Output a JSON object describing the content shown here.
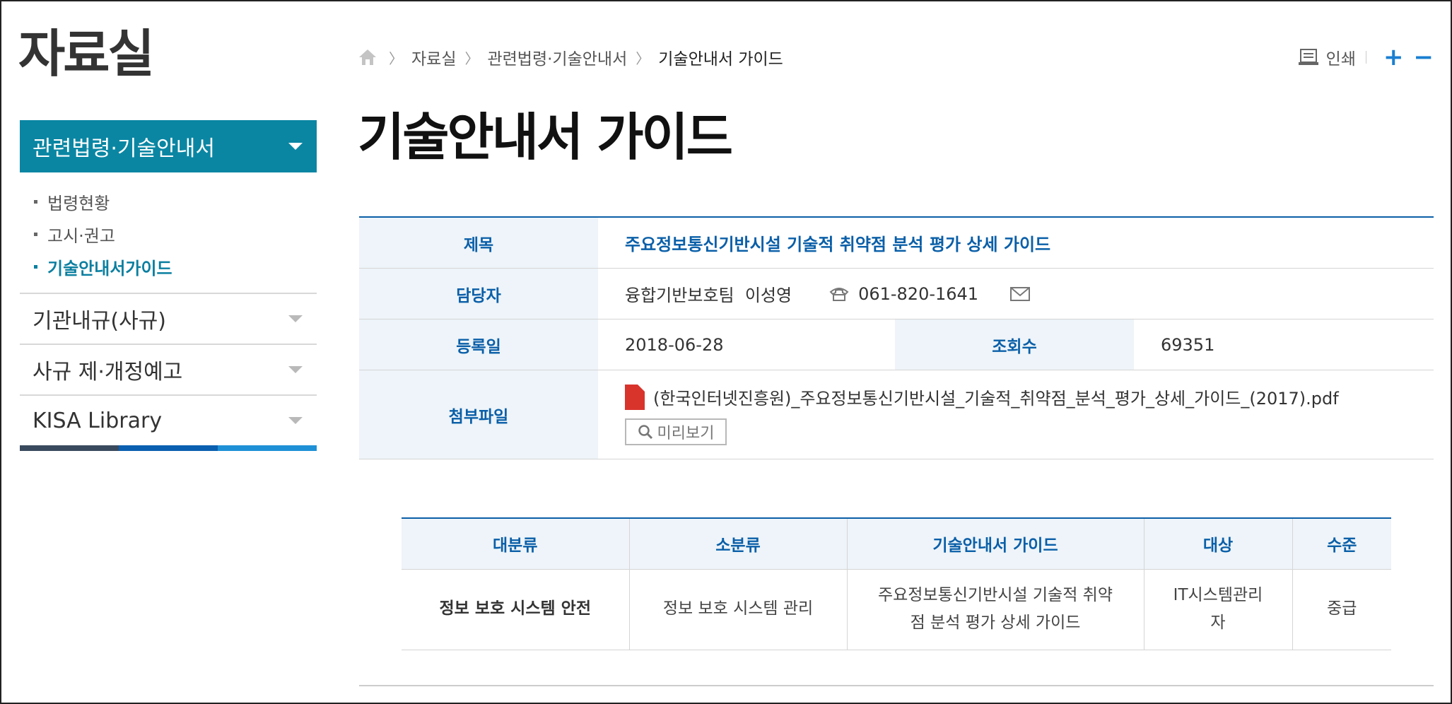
{
  "sidebar": {
    "title": "자료실",
    "active_menu": "관련법령·기술안내서",
    "sub_items": [
      {
        "label": "법령현황"
      },
      {
        "label": "고시·권고"
      },
      {
        "label": "기술안내서가이드"
      }
    ],
    "menu_items": [
      {
        "label": "기관내규(사규)"
      },
      {
        "label": "사규 제·개정예고"
      },
      {
        "label": "KISA Library"
      }
    ],
    "bottom_bar_colors": [
      "#3a4a5e",
      "#0a5fb0",
      "#1e90d6"
    ]
  },
  "breadcrumb": {
    "items": [
      "자료실",
      "관련법령·기술안내서"
    ],
    "current": "기술안내서 가이드"
  },
  "util": {
    "print_label": "인쇄",
    "zoom_in": "+",
    "zoom_out": "−"
  },
  "page": {
    "title": "기술안내서 가이드"
  },
  "detail": {
    "title_label": "제목",
    "title_value": "주요정보통신기반시설 기술적 취약점 분석 평가 상세 가이드",
    "manager_label": "담당자",
    "manager_value": "융합기반보호팀  이성영",
    "phone": "061-820-1641",
    "date_label": "등록일",
    "date_value": "2018-06-28",
    "views_label": "조회수",
    "views_value": "69351",
    "file_label": "첨부파일",
    "file_name": "(한국인터넷진흥원)_주요정보통신기반시설_기술적_취약점_분석_평가_상세_가이드_(2017).pdf",
    "preview_label": "미리보기"
  },
  "classification": {
    "headers": [
      "대분류",
      "소분류",
      "기술안내서 가이드",
      "대상",
      "수준"
    ],
    "row": {
      "major": "정보 보호 시스템 안전",
      "minor": "정보 보호 시스템 관리",
      "guide_line1": "주요정보통신기반시설 기술적 취약",
      "guide_line2": "점 분석 평가 상세 가이드",
      "target_line1": "IT시스템관리",
      "target_line2": "자",
      "level": "중급"
    }
  },
  "colors": {
    "accent": "#0a86a3",
    "link": "#0a5fa8",
    "header_bg": "#eef4f9"
  }
}
